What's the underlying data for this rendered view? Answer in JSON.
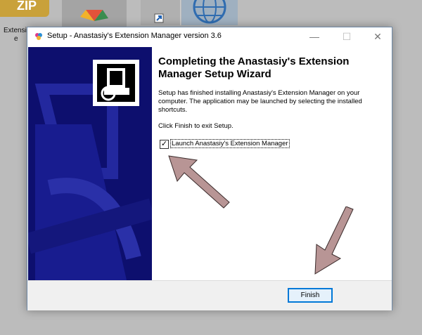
{
  "desktop": {
    "zip_icon_text": "ZIP",
    "icon_label_line1": "Extensi",
    "icon_label_line2": "e"
  },
  "dialog": {
    "title": "Setup - Anastasiy's Extension Manager version 3.6",
    "heading": "Completing the Anastasiy's Extension Manager Setup Wizard",
    "body_text": "Setup has finished installing Anastasiy's Extension Manager on your computer. The application may be launched by selecting the installed shortcuts.",
    "exit_text": "Click Finish to exit Setup.",
    "launch_checkbox": {
      "label": "Launch Anastasiy's Extension Manager",
      "checked": true,
      "check_glyph": "✓"
    },
    "finish_button": "Finish",
    "window_buttons": {
      "minimize": "—",
      "maximize": "☐",
      "close": "✕"
    }
  },
  "colors": {
    "side_panel": "#0d0f6e",
    "annotation_arrow": "#b89595",
    "button_accent": "#0078d7"
  }
}
